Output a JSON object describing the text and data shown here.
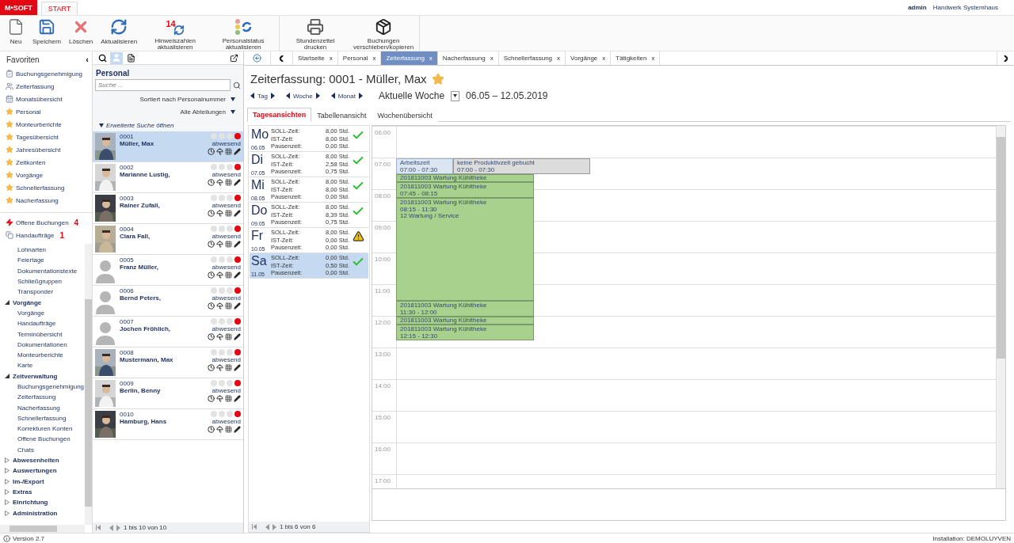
{
  "header": {
    "logo": "M•SOFT",
    "tabs": [
      {
        "label": "START",
        "selected": true
      }
    ],
    "user": "admin",
    "company": "Handwerk Systemhaus"
  },
  "toolbar": [
    {
      "buttons": [
        {
          "label": "Neu",
          "kind": "new"
        },
        {
          "label": "Speichern",
          "kind": "save"
        },
        {
          "label": "Löschen",
          "kind": "delete"
        },
        {
          "label": "Aktualisieren",
          "kind": "refresh"
        },
        {
          "label": "Hinweiszahlen aktualisieren",
          "kind": "counter",
          "badge": "14"
        },
        {
          "label": "Personalstatus aktualisieren",
          "kind": "status"
        }
      ]
    },
    {
      "buttons": [
        {
          "label": "Stundenzettel drucken",
          "kind": "print"
        },
        {
          "label": "Buchungen verschieben/kopieren",
          "kind": "box"
        }
      ]
    }
  ],
  "sidebar": {
    "title": "Favoriten",
    "collapse": "‹",
    "favorites": [
      {
        "label": "Buchungsgenehmigung",
        "kind": "clipboard"
      },
      {
        "label": "Zeiterfassung",
        "kind": "users"
      },
      {
        "label": "Monatsübersicht",
        "kind": "calendar"
      },
      {
        "label": "Personal",
        "kind": "star"
      },
      {
        "label": "Monteurberichte",
        "kind": "star"
      },
      {
        "label": "Tagesübersicht",
        "kind": "star"
      },
      {
        "label": "Jahresübersicht",
        "kind": "star"
      },
      {
        "label": "Zeitkonten",
        "kind": "star"
      },
      {
        "label": "Vorgänge",
        "kind": "star"
      },
      {
        "label": "Schnellerfassung",
        "kind": "star"
      },
      {
        "label": "Nacherfassung",
        "kind": "star"
      }
    ],
    "notices": [
      {
        "label": "Offene Buchungen",
        "count": "4",
        "kind": "bolt"
      },
      {
        "label": "Handaufträge",
        "count": "1",
        "kind": "windows"
      }
    ],
    "tree": [
      {
        "children": [
          {
            "label": "Lohnarten"
          },
          {
            "label": "Feiertage"
          },
          {
            "label": "Dokumentationstexte"
          },
          {
            "label": "Schließgruppen"
          },
          {
            "label": "Transponder"
          }
        ]
      },
      {
        "label": "Vorgänge",
        "expanded": true,
        "children": [
          {
            "label": "Vorgänge"
          },
          {
            "label": "Handaufträge"
          },
          {
            "label": "Terminübersicht"
          },
          {
            "label": "Dokumentationen"
          },
          {
            "label": "Monteurberichte"
          },
          {
            "label": "Karte"
          }
        ]
      },
      {
        "label": "Zeitverwaltung",
        "expanded": true,
        "children": [
          {
            "label": "Buchungsgenehmigung"
          },
          {
            "label": "Zeiterfassung"
          },
          {
            "label": "Nacherfassung"
          },
          {
            "label": "Schnellerfassung"
          },
          {
            "label": "Korrekturen Konten"
          },
          {
            "label": "Offene Buchungen"
          },
          {
            "label": "Chats"
          }
        ]
      },
      {
        "label": "Abwesenheiten",
        "expanded": false
      },
      {
        "label": "Auswertungen",
        "expanded": false
      },
      {
        "label": "Im-/Export",
        "expanded": false
      },
      {
        "label": "Extras",
        "expanded": false
      },
      {
        "label": "Einrichtung",
        "expanded": false
      },
      {
        "label": "Administration",
        "expanded": false
      }
    ]
  },
  "personal": {
    "title": "Personal",
    "search": {
      "placeholder": "Suche ..."
    },
    "sort": "Sortiert nach Personalnummer",
    "department": "Alle Abteilungen",
    "advanced": "Erweiterte Suche öffnen",
    "employees": [
      {
        "number": "0001",
        "name": "Müller, Max",
        "status": "abwesend",
        "avatar": {
          "kind": "picture"
        },
        "selected": true,
        "lights": [
          {
            "color": "#e3e3e3"
          },
          {
            "color": "#e3e3e3"
          },
          {
            "color": "#e3e3e3"
          },
          {
            "color": "#e30613"
          }
        ]
      },
      {
        "number": "0002",
        "name": "Marianne Lustig,",
        "status": "abwesend",
        "avatar": {
          "kind": "picture"
        },
        "selected": false,
        "lights": [
          {
            "color": "#e3e3e3"
          },
          {
            "color": "#e3e3e3"
          },
          {
            "color": "#e3e3e3"
          },
          {
            "color": "#e30613"
          }
        ]
      },
      {
        "number": "0003",
        "name": "Rainer Zufall,",
        "status": "abwesend",
        "avatar": {
          "kind": "picture"
        },
        "selected": false,
        "lights": [
          {
            "color": "#e3e3e3"
          },
          {
            "color": "#e3e3e3"
          },
          {
            "color": "#e3e3e3"
          },
          {
            "color": "#e30613"
          }
        ]
      },
      {
        "number": "0004",
        "name": "Clara Fall,",
        "status": "abwesend",
        "avatar": {
          "kind": "picture"
        },
        "selected": false,
        "lights": [
          {
            "color": "#e3e3e3"
          },
          {
            "color": "#e3e3e3"
          },
          {
            "color": "#e3e3e3"
          },
          {
            "color": "#e30613"
          }
        ]
      },
      {
        "number": "0005",
        "name": "Franz Müller,",
        "status": "abwesend",
        "avatar": {
          "kind": "silhouette"
        },
        "selected": false,
        "lights": [
          {
            "color": "#e3e3e3"
          },
          {
            "color": "#e3e3e3"
          },
          {
            "color": "#e3e3e3"
          },
          {
            "color": "#e30613"
          }
        ]
      },
      {
        "number": "0006",
        "name": "Bernd Peters,",
        "status": "abwesend",
        "avatar": {
          "kind": "silhouette"
        },
        "selected": false,
        "lights": [
          {
            "color": "#e3e3e3"
          },
          {
            "color": "#e3e3e3"
          },
          {
            "color": "#e3e3e3"
          },
          {
            "color": "#e30613"
          }
        ]
      },
      {
        "number": "0007",
        "name": "Jochen Fröhlich,",
        "status": "abwesend",
        "avatar": {
          "kind": "silhouette"
        },
        "selected": false,
        "lights": [
          {
            "color": "#e3e3e3"
          },
          {
            "color": "#e3e3e3"
          },
          {
            "color": "#e3e3e3"
          },
          {
            "color": "#e30613"
          }
        ]
      },
      {
        "number": "0008",
        "name": "Mustermann, Max",
        "status": "abwesend",
        "avatar": {
          "kind": "picture"
        },
        "selected": false,
        "lights": [
          {
            "color": "#e3e3e3"
          },
          {
            "color": "#e3e3e3"
          },
          {
            "color": "#e3e3e3"
          },
          {
            "color": "#e30613"
          }
        ]
      },
      {
        "number": "0009",
        "name": "Berlin, Benny",
        "status": "abwesend",
        "avatar": {
          "kind": "picture"
        },
        "selected": false,
        "lights": [
          {
            "color": "#e3e3e3"
          },
          {
            "color": "#e3e3e3"
          },
          {
            "color": "#e3e3e3"
          },
          {
            "color": "#e30613"
          }
        ]
      },
      {
        "number": "0010",
        "name": "Hamburg, Hans",
        "status": "abwesend",
        "avatar": {
          "kind": "picture"
        },
        "selected": false,
        "lights": [
          {
            "color": "#e3e3e3"
          },
          {
            "color": "#e3e3e3"
          },
          {
            "color": "#e3e3e3"
          },
          {
            "color": "#e30613"
          }
        ]
      }
    ],
    "pager": "1 bis 10 von 10"
  },
  "tabs": [
    {
      "label": "Startseite",
      "close": "x",
      "selected": false
    },
    {
      "label": "Personal",
      "close": "x",
      "selected": false
    },
    {
      "label": "Zeiterfassung",
      "close": "x",
      "selected": true
    },
    {
      "label": "Nacherfassung",
      "close": "x",
      "selected": false
    },
    {
      "label": "Schnellerfassung",
      "close": "x",
      "selected": false
    },
    {
      "label": "Vorgänge",
      "close": "x",
      "selected": false
    },
    {
      "label": "Tätigkeiten",
      "close": "x",
      "selected": false
    }
  ],
  "title": "Zeiterfassung: 0001 - Müller, Max",
  "favorite": true,
  "nav": [
    "Tag",
    "Woche",
    "Monat"
  ],
  "period": "Aktuelle Woche",
  "range": "06.05 – 12.05.2019",
  "views": [
    {
      "label": "Tagesansichten",
      "selected": true
    },
    {
      "label": "Tabellenansicht",
      "selected": false
    },
    {
      "label": "Wochenübersicht",
      "selected": false
    }
  ],
  "days": [
    {
      "day": "Mo",
      "date": "06.05",
      "kind": "ok",
      "selected": false,
      "lines": [
        {
          "label": "SOLL-Zeit:",
          "value": "8,00 Std."
        },
        {
          "label": "IST-Zeit:",
          "value": "8,00 Std."
        },
        {
          "label": "Pausenzeit:",
          "value": "0,00 Std."
        }
      ]
    },
    {
      "day": "Di",
      "date": "07.05",
      "kind": "ok",
      "selected": false,
      "lines": [
        {
          "label": "SOLL-Zeit:",
          "value": "8,00 Std."
        },
        {
          "label": "IST-Zeit:",
          "value": "2,58 Std."
        },
        {
          "label": "Pausenzeit:",
          "value": "0,75 Std."
        }
      ]
    },
    {
      "day": "Mi",
      "date": "08.05",
      "kind": "ok",
      "selected": false,
      "lines": [
        {
          "label": "SOLL-Zeit:",
          "value": "8,00 Std."
        },
        {
          "label": "IST-Zeit:",
          "value": "8,00 Std."
        },
        {
          "label": "Pausenzeit:",
          "value": "0,00 Std."
        }
      ]
    },
    {
      "day": "Do",
      "date": "09.05",
      "kind": "ok",
      "selected": false,
      "lines": [
        {
          "label": "SOLL-Zeit:",
          "value": "8,00 Std."
        },
        {
          "label": "IST-Zeit:",
          "value": "8,39 Std."
        },
        {
          "label": "Pausenzeit:",
          "value": "0,75 Std."
        }
      ]
    },
    {
      "day": "Fr",
      "date": "10.05",
      "kind": "warning",
      "selected": false,
      "lines": [
        {
          "label": "SOLL-Zeit:",
          "value": "8,00 Std."
        },
        {
          "label": "IST-Zeit:",
          "value": "0,00 Std."
        },
        {
          "label": "Pausenzeit:",
          "value": "0,00 Std."
        }
      ]
    },
    {
      "day": "Sa",
      "date": "11.05",
      "kind": "ok",
      "selected": true,
      "lines": [
        {
          "label": "SOLL-Zeit:",
          "value": "0,00 Std."
        },
        {
          "label": "IST-Zeit:",
          "value": "0,50 Std."
        },
        {
          "label": "Pausenzeit:",
          "value": "0,00 Std."
        }
      ]
    }
  ],
  "days_pager": "1 bis 6 von 6",
  "hours": [
    "06:00",
    "07:00",
    "08:00",
    "09:00",
    "10:00",
    "11:00",
    "12:00",
    "13:00",
    "14:00",
    "15:00",
    "16:00",
    "17:00"
  ],
  "events": [
    {
      "kind": "work",
      "title": "Arbeitszeit",
      "time": "07:00 - 07:30"
    },
    {
      "kind": "note",
      "title": "keine Produktivzeit gebucht",
      "time": "07:00 - 07:30"
    },
    {
      "kind": "task-short",
      "title": "201811003 Wartung Kühltheke"
    },
    {
      "kind": "task",
      "title": "201811003 Wartung Kühltheke",
      "time": "07:45 - 08:15"
    },
    {
      "kind": "task",
      "title": "201811003 Wartung Kühltheke",
      "time": "08:15 - 11:30",
      "note": "12 Wartung / Service"
    },
    {
      "kind": "task",
      "title": "201811003 Wartung Kühltheke",
      "time": "11:30 - 12:00"
    },
    {
      "kind": "task-short",
      "title": "201811003 Wartung Kühltheke"
    },
    {
      "kind": "task",
      "title": "201811003 Wartung Kühltheke",
      "time": "12:15 - 12:30"
    }
  ],
  "status_bar": {
    "version": "Version 2.7",
    "installation": "Installation: DEMOLUYVEN"
  }
}
